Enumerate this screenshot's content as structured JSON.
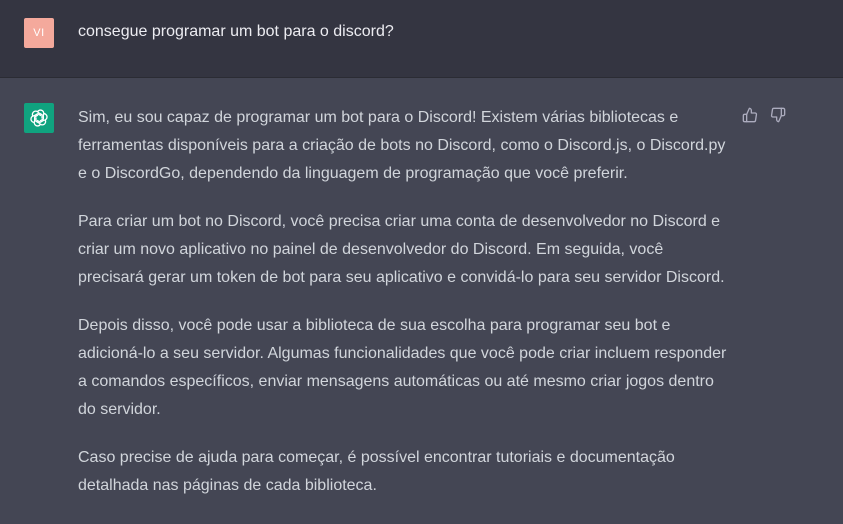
{
  "user_message": {
    "avatar_initials": "VI",
    "avatar_color": "#f4a99c",
    "text": "consegue programar um bot para o discord?"
  },
  "assistant_message": {
    "avatar_icon": "openai-logo-icon",
    "avatar_color": "#10a37f",
    "paragraphs": [
      "Sim, eu sou capaz de programar um bot para o Discord! Existem várias bibliotecas e ferramentas disponíveis para a criação de bots no Discord, como o Discord.js, o Discord.py e o DiscordGo, dependendo da linguagem de programação que você preferir.",
      "Para criar um bot no Discord, você precisa criar uma conta de desenvolvedor no Discord e criar um novo aplicativo no painel de desenvolvedor do Discord. Em seguida, você precisará gerar um token de bot para seu aplicativo e convidá-lo para seu servidor Discord.",
      "Depois disso, você pode usar a biblioteca de sua escolha para programar seu bot e adicioná-lo a seu servidor. Algumas funcionalidades que você pode criar incluem responder a comandos específicos, enviar mensagens automáticas ou até mesmo criar jogos dentro do servidor.",
      "Caso precise de ajuda para começar, é possível encontrar tutoriais e documentação detalhada nas páginas de cada biblioteca."
    ],
    "feedback": {
      "like_icon": "thumbs-up-icon",
      "dislike_icon": "thumbs-down-icon"
    }
  },
  "colors": {
    "user_row_bg": "#343541",
    "assistant_row_bg": "#444654",
    "text": "#d1d5db"
  }
}
